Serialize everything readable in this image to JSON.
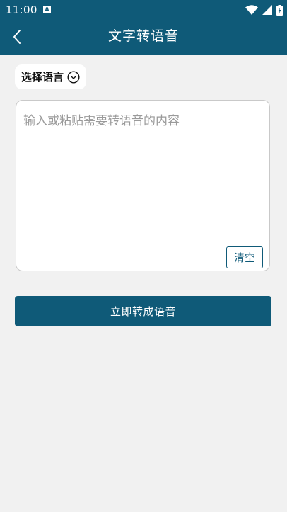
{
  "status_bar": {
    "time": "11:00",
    "notification_icon": "A",
    "icons": [
      "wifi-icon",
      "cell-signal-icon",
      "battery-icon"
    ]
  },
  "header": {
    "title": "文字转语音",
    "back_icon": "chevron-left-icon"
  },
  "language_selector": {
    "label": "选择语言",
    "icon": "chevron-down-circle-icon"
  },
  "editor": {
    "placeholder": "输入或粘贴需要转语音的内容",
    "value": "",
    "clear_label": "清空"
  },
  "actions": {
    "convert_label": "立即转成语音"
  },
  "colors": {
    "primary": "#0f5a78",
    "background": "#f1f1f1",
    "card": "#ffffff"
  }
}
